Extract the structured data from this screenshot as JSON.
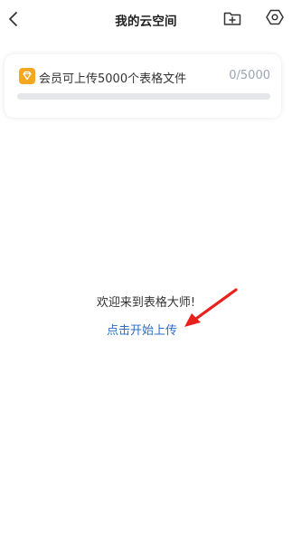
{
  "header": {
    "title": "我的云空间",
    "back_icon": "chevron-left-icon",
    "add_folder_icon": "folder-plus-icon",
    "settings_icon": "hexagon-settings-icon"
  },
  "quota": {
    "icon": "diamond-icon",
    "label": "会员可上传5000个表格文件",
    "count": "0/5000",
    "used": 0,
    "total": 5000,
    "accent_color": "#f5a623"
  },
  "empty_state": {
    "welcome": "欢迎来到表格大师!",
    "upload_link": "点击开始上传",
    "link_color": "#2a6fc8",
    "arrow_color": "#e8211d"
  }
}
